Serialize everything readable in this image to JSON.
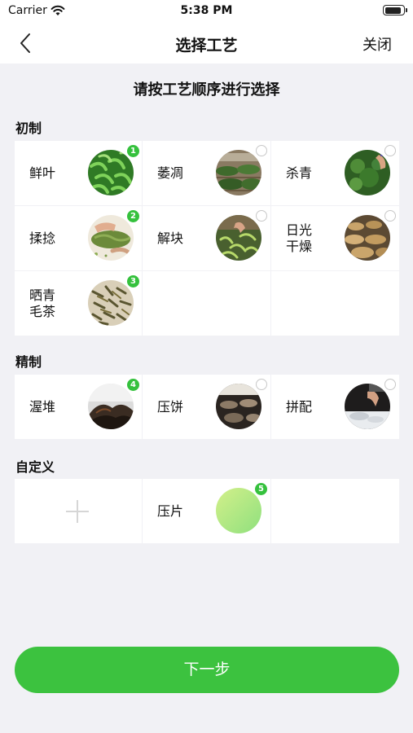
{
  "status_bar": {
    "carrier": "Carrier",
    "time": "5:38 PM"
  },
  "nav": {
    "title": "选择工艺",
    "close_label": "关闭",
    "back_icon": "chevron-left-icon"
  },
  "instruction": "请按工艺顺序进行选择",
  "sections": {
    "primary": {
      "label": "初制",
      "items": [
        {
          "label": "鲜叶",
          "selected": true,
          "order": "1"
        },
        {
          "label": "萎凋",
          "selected": false,
          "order": ""
        },
        {
          "label": "杀青",
          "selected": false,
          "order": ""
        },
        {
          "label": "揉捻",
          "selected": true,
          "order": "2"
        },
        {
          "label": "解块",
          "selected": false,
          "order": ""
        },
        {
          "label": "日光干燥",
          "selected": false,
          "order": ""
        },
        {
          "label": "晒青毛茶",
          "selected": true,
          "order": "3"
        }
      ]
    },
    "refined": {
      "label": "精制",
      "items": [
        {
          "label": "渥堆",
          "selected": true,
          "order": "4"
        },
        {
          "label": "压饼",
          "selected": false,
          "order": ""
        },
        {
          "label": "拼配",
          "selected": false,
          "order": ""
        }
      ]
    },
    "custom": {
      "label": "自定义",
      "add_icon": "plus-icon",
      "items": [
        {
          "label": "压片",
          "selected": true,
          "order": "5"
        }
      ]
    }
  },
  "next_button_label": "下一步",
  "colors": {
    "accent": "#3cc23f",
    "badge": "#35c13d",
    "background": "#f1f1f5"
  }
}
